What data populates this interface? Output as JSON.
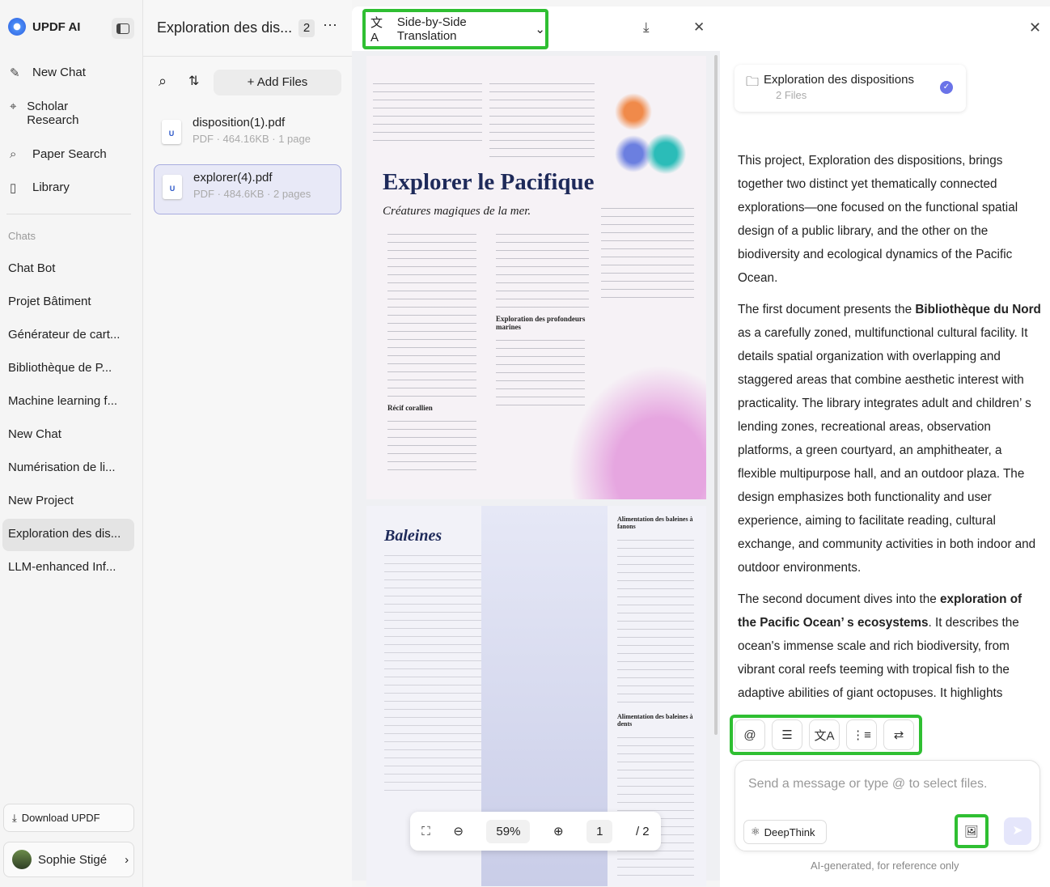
{
  "sidebar": {
    "app_name": "UPDF AI",
    "nav": [
      {
        "label": "New Chat"
      },
      {
        "label": "Scholar Research"
      },
      {
        "label": "Paper Search"
      },
      {
        "label": "Library"
      }
    ],
    "chats_heading": "Chats",
    "chats": [
      "Chat Bot",
      "Projet Bâtiment",
      "Générateur de cart...",
      "Bibliothèque de P...",
      "Machine learning f...",
      "New Chat",
      "Numérisation de li...",
      "New Project",
      "Exploration des dis...",
      "LLM-enhanced Inf..."
    ],
    "download": "Download UPDF",
    "user": "Sophie Stigé"
  },
  "files": {
    "title": "Exploration des dis...",
    "count": "2",
    "add_files": "+ Add Files",
    "items": [
      {
        "name": "disposition(1).pdf",
        "meta": "PDF · 464.16KB · 1 page"
      },
      {
        "name": "explorer(4).pdf",
        "meta": "PDF · 484.6KB · 2 pages"
      }
    ]
  },
  "viewer": {
    "mode": "Side-by-Side Translation",
    "page1": {
      "title": "Explorer le Pacifique",
      "subtitle": "Créatures magiques de la mer.",
      "h1": "Récif corallien",
      "h2": "Exploration des profondeurs marines"
    },
    "page2": {
      "title": "Baleines",
      "h1": "Alimentation des baleines à fanons",
      "h2": "Alimentation des baleines à dents"
    },
    "zoom": "59%",
    "page": "1",
    "total": "/ 2"
  },
  "chat": {
    "card_title": "Exploration des dispositions",
    "card_sub": "2 Files",
    "p1": "This project, Exploration des dispositions, brings together two distinct yet thematically connected explorations—one focused on the functional spatial design of a public library, and the other on the biodiversity and ecological dynamics of the Pacific Ocean.",
    "p2a": "The first document presents the ",
    "p2b": "Bibliothèque du Nord",
    "p2c": " as a carefully zoned, multifunctional cultural facility. It details spatial organization with overlapping and staggered areas that combine aesthetic interest with practicality. The library integrates adult and children’ s lending zones, recreational areas, observation platforms, a green courtyard, an amphitheater, a flexible multipurpose hall, and an outdoor plaza. The design emphasizes both functionality and user experience, aiming to facilitate reading, cultural exchange, and community activities in both indoor and outdoor environments.",
    "p3a": "The second document dives into the ",
    "p3b": "exploration of the Pacific Ocean’ s ecosystems",
    "p3c": ". It describes the ocean's immense scale and rich biodiversity, from vibrant coral reefs teeming with tropical fish to the adaptive abilities of giant octopuses. It highlights",
    "placeholder": "Send a message or type @ to select files.",
    "deepthink": "DeepThink",
    "footer": "AI-generated, for reference only"
  }
}
